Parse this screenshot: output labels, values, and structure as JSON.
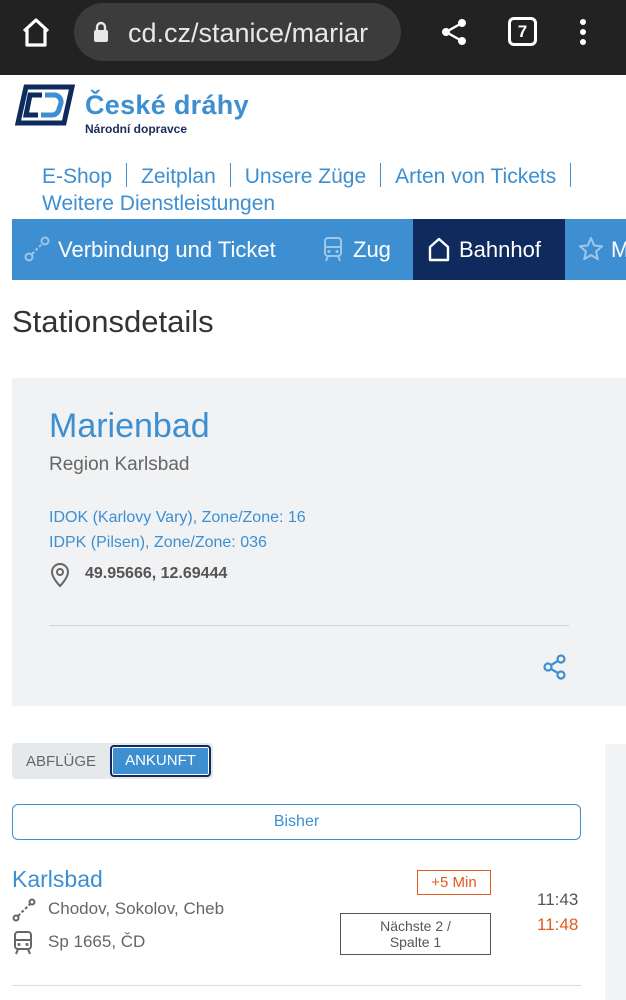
{
  "browser": {
    "url": "cd.cz/stanice/mariar",
    "tab_count": "7",
    "icons": [
      "home-icon",
      "lock-icon",
      "share-icon",
      "tabs-icon",
      "menu-icon"
    ]
  },
  "header": {
    "brand_name": "České dráhy",
    "brand_tagline": "Národní dopravce"
  },
  "topnav": {
    "items": [
      "E-Shop",
      "Zeitplan",
      "Unsere Züge",
      "Arten von Tickets",
      "Weitere Dienstleistungen"
    ]
  },
  "tabs": [
    {
      "label": "Verbindung und Ticket",
      "icon": "route-icon"
    },
    {
      "label": "Zug",
      "icon": "train-icon"
    },
    {
      "label": "Bahnhof",
      "icon": "station-icon",
      "active": true
    },
    {
      "label": "M",
      "icon": "star-icon"
    }
  ],
  "page": {
    "title": "Stationsdetails"
  },
  "station": {
    "name": "Marienbad",
    "region": "Region Karlsbad",
    "zone_1": "IDOK (Karlovy Vary), Zone/Zone: 16",
    "zone_2": "IDPK (Pilsen), Zone/Zone: 036",
    "coordinates": "49.95666, 12.69444"
  },
  "board": {
    "toggle_departures": "ABFLÜGE",
    "toggle_arrivals": "ANKUNFT",
    "earlier_button": "Bisher"
  },
  "arrival": {
    "from": "Karlsbad",
    "delay": "+5 Min",
    "via": "Chodov, Sokolov, Cheb",
    "train": "Sp 1665, ČD",
    "scheduled": "11:43",
    "actual": "11:48",
    "platform_line1": "Nächste 2 /",
    "platform_line2": "Spalte 1"
  },
  "colors": {
    "accent": "#3d8fd1",
    "dark_navy": "#0f2a5c",
    "delay": "#e35a1c"
  }
}
